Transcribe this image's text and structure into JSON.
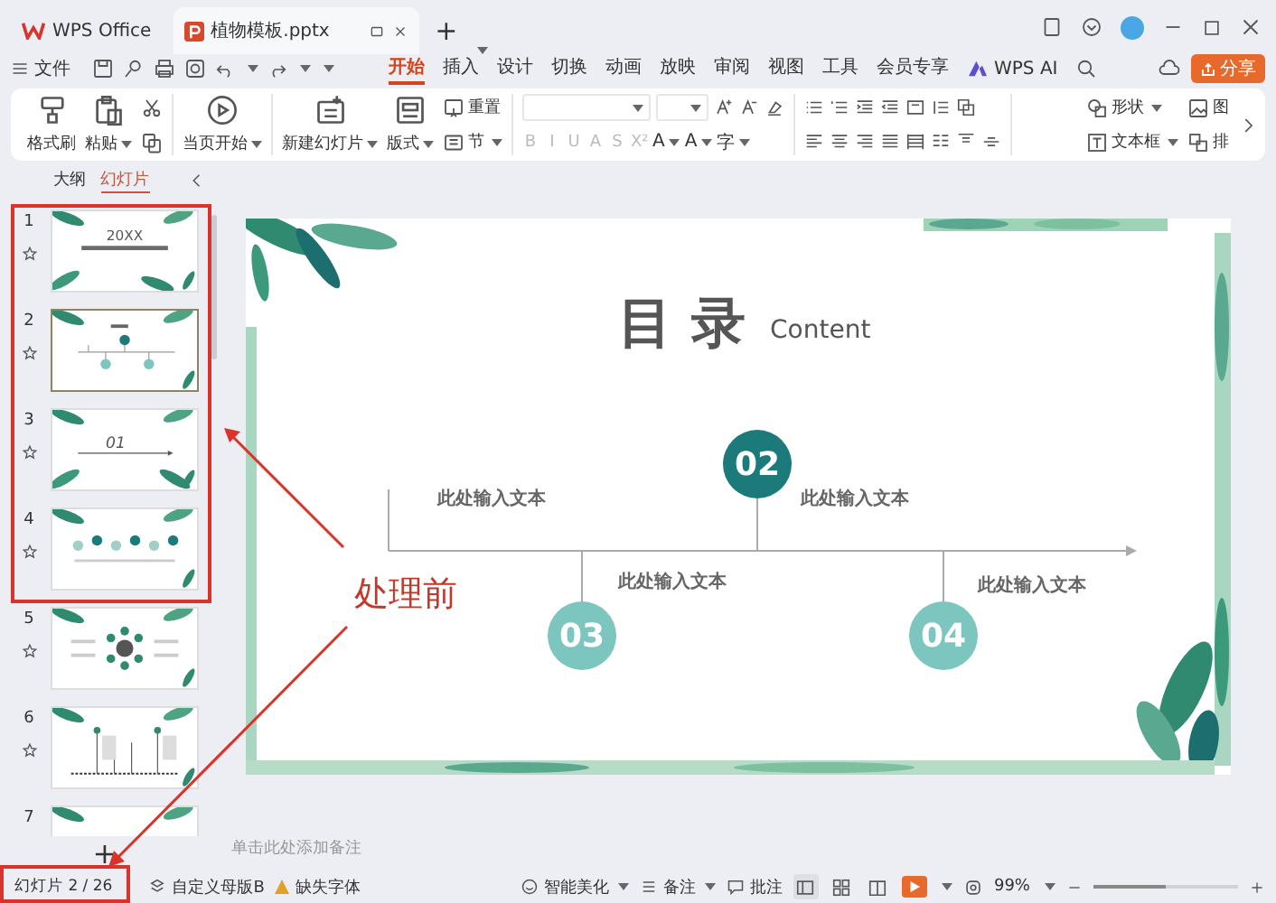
{
  "title_bar": {
    "tabs": [
      {
        "label": "WPS Office",
        "kind": "home",
        "selected": false
      },
      {
        "label": "植物模板.pptx",
        "kind": "presentation",
        "selected": true
      }
    ],
    "new_tab": "+"
  },
  "menu": {
    "file": "文件",
    "tabs": [
      {
        "label": "开始",
        "selected": true
      },
      {
        "label": "插入",
        "selected": false
      },
      {
        "label": "设计",
        "selected": false
      },
      {
        "label": "切换",
        "selected": false
      },
      {
        "label": "动画",
        "selected": false
      },
      {
        "label": "放映",
        "selected": false
      },
      {
        "label": "审阅",
        "selected": false
      },
      {
        "label": "视图",
        "selected": false
      },
      {
        "label": "工具",
        "selected": false
      },
      {
        "label": "会员专享",
        "selected": false
      }
    ],
    "ai": "WPS AI",
    "share": "分享"
  },
  "ribbon": {
    "groups": [
      {
        "kind": "buttons",
        "items": [
          {
            "kind": "brush",
            "label": "格式刷",
            "dropdown": false
          },
          {
            "kind": "paste",
            "label": "粘贴",
            "dropdown": true
          },
          {
            "kind": "stack",
            "items": [
              {
                "kind": "cut",
                "dropdown": false
              },
              {
                "kind": "copy",
                "dropdown": false
              }
            ]
          }
        ]
      },
      {
        "kind": "buttons",
        "items": [
          {
            "kind": "play",
            "label": "当页开始",
            "dropdown": true
          }
        ]
      },
      {
        "kind": "buttons",
        "items": [
          {
            "kind": "new_slide",
            "label": "新建幻灯片",
            "dropdown": true
          },
          {
            "kind": "layout",
            "label": "版式",
            "dropdown": true
          },
          {
            "kind": "stack",
            "items": [
              {
                "kind": "reset",
                "label": "重置",
                "dropdown": false
              },
              {
                "kind": "section",
                "label": "节",
                "dropdown": true
              }
            ]
          }
        ]
      },
      {
        "kind": "font",
        "disabled": true,
        "format_buttons": [
          "B",
          "I",
          "U",
          "A",
          "S",
          "X²"
        ],
        "style_buttons": [
          "A",
          "A",
          "字"
        ]
      },
      {
        "kind": "paragraph"
      },
      {
        "kind": "buttons",
        "items": [
          {
            "kind": "stack",
            "items": [
              {
                "kind": "shape",
                "label": "形状",
                "dropdown": true
              },
              {
                "kind": "textbox",
                "label": "文本框",
                "dropdown": true
              }
            ]
          },
          {
            "kind": "stack",
            "items": [
              {
                "kind": "picture",
                "label": "图",
                "dropdown": false
              },
              {
                "kind": "arrange",
                "label": "排",
                "dropdown": false
              }
            ]
          }
        ]
      }
    ]
  },
  "left_panel": {
    "tabs": [
      {
        "label": "大纲",
        "selected": false
      },
      {
        "label": "幻灯片",
        "selected": true
      }
    ],
    "slides": [
      {
        "number": "1",
        "kind": "title",
        "title": "20XX",
        "selected": false
      },
      {
        "number": "2",
        "kind": "contents",
        "selected": true
      },
      {
        "number": "3",
        "kind": "section",
        "title": "01",
        "selected": false
      },
      {
        "number": "4",
        "kind": "steps",
        "selected": false
      },
      {
        "number": "5",
        "kind": "hub",
        "selected": false
      },
      {
        "number": "6",
        "kind": "timeline",
        "selected": false
      },
      {
        "number": "7",
        "kind": "title",
        "selected": false
      }
    ],
    "add": "+"
  },
  "slide": {
    "title": "目 录",
    "subtitle": "Content",
    "nodes": [
      {
        "number": "02",
        "color": "#1c7a7a"
      },
      {
        "number": "03",
        "color": "#7dc6c0"
      },
      {
        "number": "04",
        "color": "#7dc6c0"
      }
    ],
    "labels": [
      "此处输入文本",
      "此处输入文本",
      "此处输入文本",
      "此处输入文本"
    ]
  },
  "notes": {
    "placeholder": "单击此处添加备注"
  },
  "status_bar": {
    "slide_counter": "幻灯片 2 / 26",
    "theme": "自定义母版B",
    "missing_fonts": "缺失字体",
    "beautify": "智能美化",
    "notes": "备注",
    "comments": "批注",
    "views": [
      {
        "kind": "normal",
        "selected": true
      },
      {
        "kind": "sorter",
        "selected": false
      },
      {
        "kind": "reading",
        "selected": false
      }
    ],
    "zoom": "99%",
    "zoom_slider": {
      "level": 0.5
    }
  },
  "annotation": {
    "label": "处理前"
  }
}
